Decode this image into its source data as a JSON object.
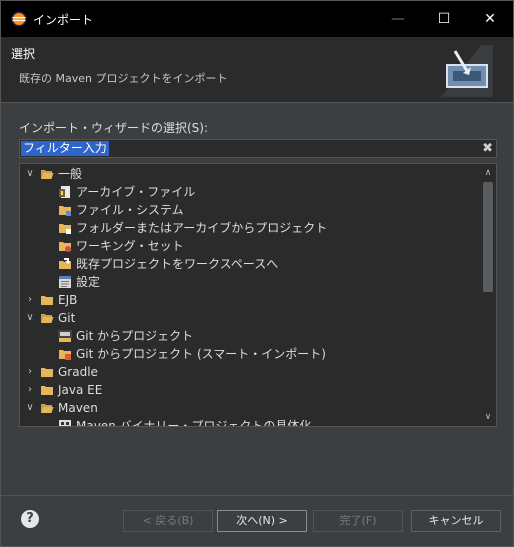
{
  "window": {
    "title": "インポート",
    "minimize_glyph": "—",
    "maximize_glyph": "☐",
    "close_glyph": "✕"
  },
  "header": {
    "title": "選択",
    "description": "既存の Maven プロジェクトをインポート"
  },
  "filter": {
    "label": "インポート・ウィザードの選択(S):",
    "value": "フィルター入力",
    "clear_glyph": "✖"
  },
  "tree": {
    "items": [
      {
        "label": "一般",
        "expanded": true,
        "icon": "folder-open-icon"
      },
      {
        "label": "アーカイブ・ファイル",
        "icon": "archive-file-icon"
      },
      {
        "label": "ファイル・システム",
        "icon": "filesystem-folder-icon"
      },
      {
        "label": "フォルダーまたはアーカイブからプロジェクト",
        "icon": "project-folder-icon"
      },
      {
        "label": "ワーキング・セット",
        "icon": "working-set-icon"
      },
      {
        "label": "既存プロジェクトをワークスペースへ",
        "icon": "existing-project-icon"
      },
      {
        "label": "設定",
        "icon": "preferences-icon"
      },
      {
        "label": "EJB",
        "expanded": false,
        "icon": "folder-icon"
      },
      {
        "label": "Git",
        "expanded": true,
        "icon": "folder-open-icon"
      },
      {
        "label": "Git からプロジェクト",
        "icon": "git-project-icon"
      },
      {
        "label": "Git からプロジェクト (スマート・インポート)",
        "icon": "git-smart-import-icon"
      },
      {
        "label": "Gradle",
        "expanded": false,
        "icon": "folder-icon"
      },
      {
        "label": "Java EE",
        "expanded": false,
        "icon": "folder-icon"
      },
      {
        "label": "Maven",
        "expanded": true,
        "icon": "folder-open-icon"
      },
      {
        "label": "Maven バイナリー・プロジェクトの具体化",
        "icon": "maven-binary-icon"
      }
    ]
  },
  "buttons": {
    "back": "< 戻る(B)",
    "next": "次へ(N) >",
    "finish": "完了(F)",
    "cancel": "キャンセル",
    "help": "?"
  },
  "colors": {
    "background": "#3c3f41",
    "panel": "#2b2b2b",
    "selection": "#2f65ca",
    "folder": "#e5b65a"
  }
}
